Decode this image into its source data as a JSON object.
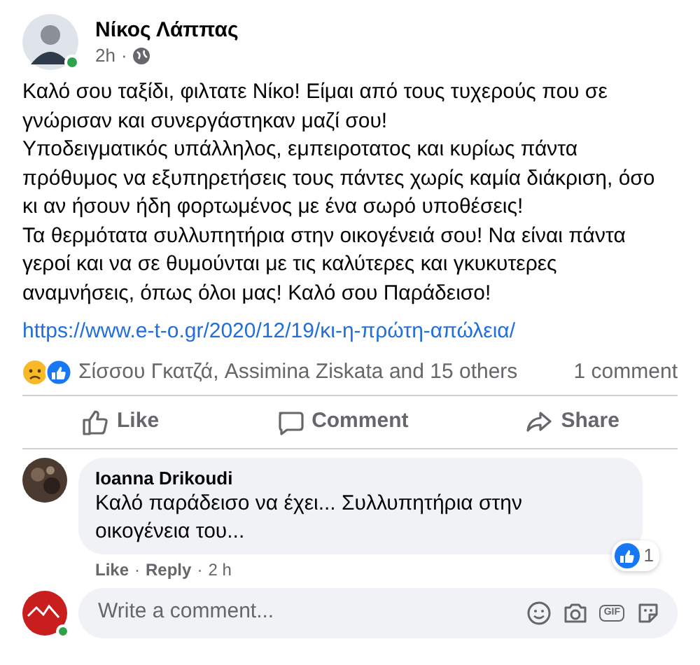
{
  "author": {
    "name": "Νίκος Λάππας",
    "time": "2h",
    "separator": "·",
    "online": true
  },
  "post": {
    "paragraphs": [
      "Καλό σου ταξίδι, φιλτατε Νίκο! Είμαι από τους τυχερούς που σε γνώρισαν και συνεργάστηκαν μαζί σου!",
      "Υποδειγματικός υπάλληλος, εμπειροτατος και κυρίως πάντα πρόθυμος να εξυπηρετήσεις τους πάντες χωρίς καμία διάκριση, όσο κι αν ήσουν ήδη φορτωμένος με ένα σωρό υποθέσεις!",
      "Τα θερμότατα συλλυπητήρια στην οικογένειά σου! Να είναι πάντα γεροί και να σε θυμούνται με τις καλύτερες και γκυκυτερες αναμνήσεις, όπως όλοι μας! Καλό σου Παράδεισο!"
    ],
    "link": "https://www.e-t-o.gr/2020/12/19/κι-η-πρώτη-απώλεια/"
  },
  "reactions": {
    "summary": "Σίσσου Γκατζά, Assimina Ziskata and 15 others",
    "comments_count": "1 comment"
  },
  "actions": [
    {
      "kind": "like",
      "label": "Like"
    },
    {
      "kind": "comment",
      "label": "Comment"
    },
    {
      "kind": "share",
      "label": "Share"
    }
  ],
  "comments": [
    {
      "author": "Ioanna Drikoudi",
      "text": "Καλό παράδεισο να έχει... Συλλυπητήρια στην οικογένεια του...",
      "links": [
        "Like",
        "Reply"
      ],
      "separator": "·",
      "time": "2 h",
      "like_count": "1"
    }
  ],
  "composer": {
    "placeholder": "Write a comment...",
    "online": true,
    "gif_label": "GIF"
  }
}
